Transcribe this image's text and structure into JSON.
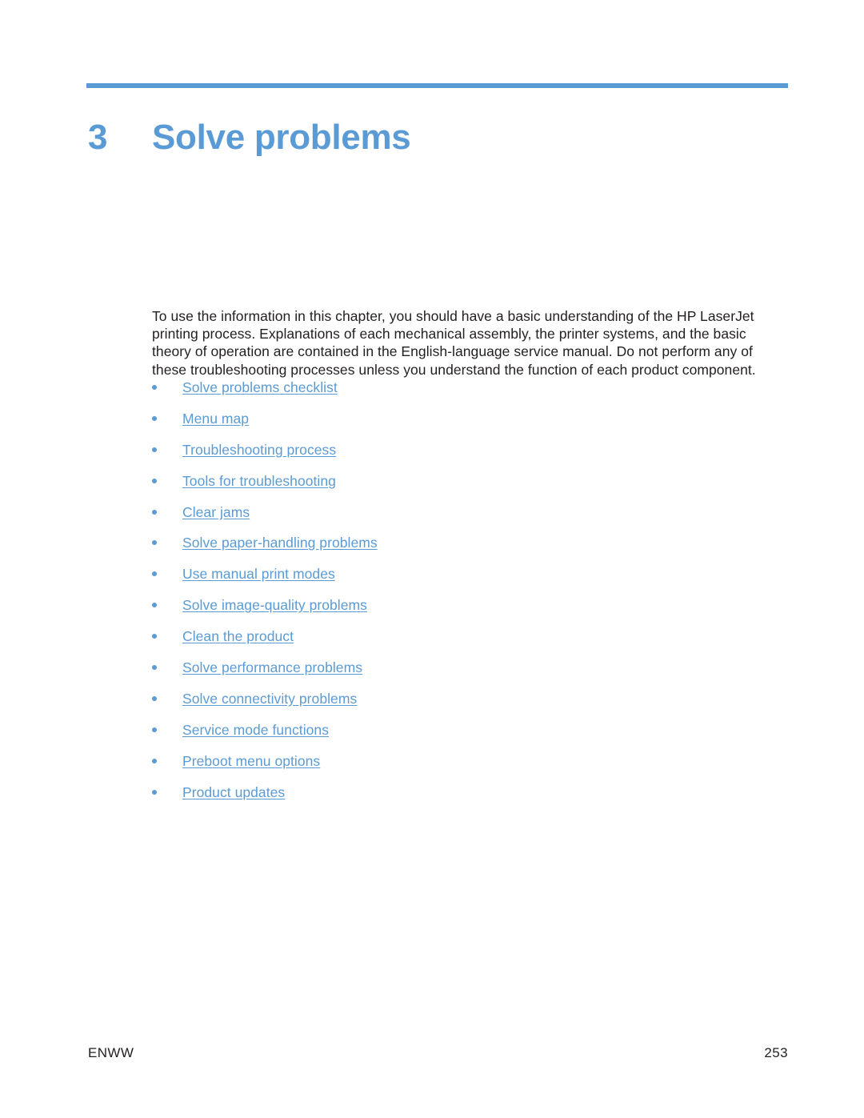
{
  "document": {
    "chapter_number": "3",
    "chapter_title": "Solve problems",
    "accent_color": "#5b9bd5",
    "text_color": "#231f20",
    "background_color": "#ffffff"
  },
  "intro": {
    "paragraph": "To use the information in this chapter, you should have a basic understanding of the HP LaserJet printing process. Explanations of each mechanical assembly, the printer systems, and the basic theory of operation are contained in the English-language service manual. Do not perform any of these troubleshooting processes unless you understand the function of each product component."
  },
  "links": [
    {
      "label": "Solve problems checklist"
    },
    {
      "label": "Menu map"
    },
    {
      "label": "Troubleshooting process"
    },
    {
      "label": "Tools for troubleshooting"
    },
    {
      "label": "Clear jams"
    },
    {
      "label": "Solve paper-handling problems"
    },
    {
      "label": "Use manual print modes"
    },
    {
      "label": "Solve image-quality problems"
    },
    {
      "label": "Clean the product"
    },
    {
      "label": "Solve performance problems"
    },
    {
      "label": "Solve connectivity problems"
    },
    {
      "label": "Service mode functions"
    },
    {
      "label": "Preboot menu options"
    },
    {
      "label": "Product updates"
    }
  ],
  "footer": {
    "left": "ENWW",
    "right": "253"
  }
}
